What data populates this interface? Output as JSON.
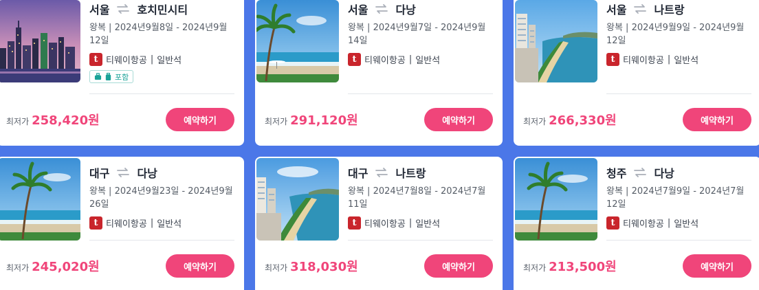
{
  "deals": [
    {
      "image": "saigon-city-skyline",
      "origin": "서울",
      "destination": "호치민시티",
      "dates": "왕복 | 2024년9월8일 - 2024년9월12일",
      "airline": "티웨이항공",
      "cabin": "일반석",
      "baggage": "포함",
      "price_label": "최저가",
      "price": "258,420원",
      "book_label": "예약하기"
    },
    {
      "image": "palm-beach",
      "origin": "서울",
      "destination": "다낭",
      "dates": "왕복 | 2024년9월7일 - 2024년9월14일",
      "airline": "티웨이항공",
      "cabin": "일반석",
      "price_label": "최저가",
      "price": "291,120원",
      "book_label": "예약하기"
    },
    {
      "image": "coastal-city",
      "origin": "서울",
      "destination": "나트랑",
      "dates": "왕복 | 2024년9월9일 - 2024년9월12일",
      "airline": "티웨이항공",
      "cabin": "일반석",
      "price_label": "최저가",
      "price": "266,330원",
      "book_label": "예약하기"
    },
    {
      "image": "palm-beach",
      "origin": "대구",
      "destination": "다낭",
      "dates": "왕복 | 2024년9월23일 - 2024년9월26일",
      "airline": "티웨이항공",
      "cabin": "일반석",
      "price_label": "최저가",
      "price": "245,020원",
      "book_label": "예약하기"
    },
    {
      "image": "coastal-city",
      "origin": "대구",
      "destination": "나트랑",
      "dates": "왕복 | 2024년7월8일 - 2024년7월11일",
      "airline": "티웨이항공",
      "cabin": "일반석",
      "price_label": "최저가",
      "price": "318,030원",
      "book_label": "예약하기"
    },
    {
      "image": "palm-beach",
      "origin": "청주",
      "destination": "다낭",
      "dates": "왕복 | 2024년7월9일 - 2024년7월12일",
      "airline": "티웨이항공",
      "cabin": "일반석",
      "price_label": "최저가",
      "price": "213,500원",
      "book_label": "예약하기"
    }
  ],
  "airline_logo_letter": "t",
  "colors": {
    "background": "#4b77e8",
    "accent": "#f0457a",
    "airline": "#c9252c",
    "baggage": "#1aa398"
  }
}
